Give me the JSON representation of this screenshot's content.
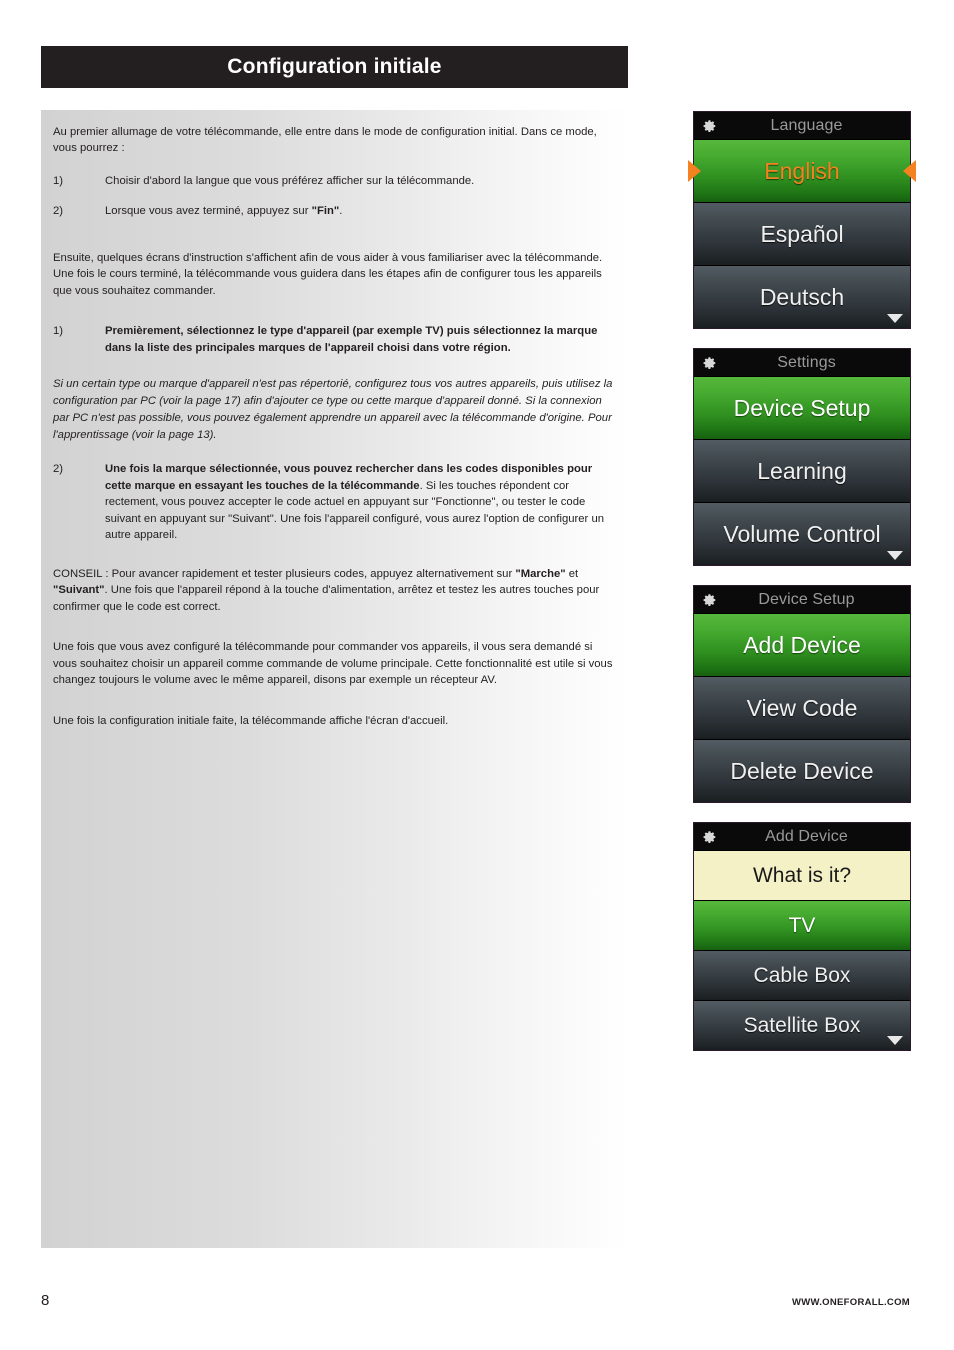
{
  "page": {
    "title": "Configuration initiale",
    "page_number": "8",
    "footer_url": "WWW.ONEFORALL.COM"
  },
  "content": {
    "intro": "Au premier allumage de votre télécommande, elle entre dans le mode de configuration initial. Dans ce mode, vous pourrez :",
    "list1": [
      {
        "num": "1)",
        "text": "Choisir d'abord la langue que vous préférez afficher sur la télécommande."
      },
      {
        "num": "2)",
        "text_before": "Lorsque vous avez terminé, appuyez sur ",
        "bold": "\"Fin\"",
        "text_after": "."
      }
    ],
    "para2": "Ensuite, quelques écrans d'instruction s'affichent afin de vous aider à vous familiariser avec la télécommande. Une fois le cours terminé, la télécommande vous guidera dans les étapes afin de configurer tous les appareils que vous souhaitez commander.",
    "item1_num": "1)",
    "item1_text": "Premièrement, sélectionnez le type d'appareil (par exemple TV) puis sélectionnez la marque dans la liste des principales marques de l'appareil choisi dans votre région.",
    "italic_note": "Si un certain type ou marque d'appareil n'est pas répertorié, configurez tous vos autres appareils, puis utilisez la configuration par PC (voir la page 17) afin d'ajouter ce type ou cette marque d'appareil donné. Si la connexion par PC n'est pas possible, vous pouvez également apprendre un appareil avec la télécommande d'origine. Pour l'apprentissage (voir la page 13).",
    "item2_num": "2)",
    "item2_bold": "Une fois la marque sélectionnée, vous pouvez rechercher dans les codes disponibles pour cette marque en essayant les touches de la télécommande",
    "item2_rest": ". Si les touches répondent cor rectement, vous pouvez accepter le code actuel en appuyant sur \"Fonctionne\", ou tester le code suivant en appuyant sur \"Suivant\". Une fois l'appareil configuré, vous aurez l'option de configurer un autre appareil.",
    "tip_before": "CONSEIL : Pour avancer rapidement et tester plusieurs codes, appuyez alternativement sur ",
    "tip_bold1": "\"Marche\"",
    "tip_mid": " et ",
    "tip_bold2": "\"Suivant\"",
    "tip_after": ". Une fois que l'appareil répond à la touche d'alimentation, arrêtez et testez les autres touches pour confirmer que le code est correct.",
    "para_volume": "Une fois que vous avez configuré la télécommande pour commander vos appareils, il vous sera demandé si vous souhaitez choisir un appareil comme commande de volume principale. Cette fonctionnalité est utile si vous changez toujours le volume avec le même appareil, disons par exemple un récepteur AV.",
    "para_final": "Une fois la configuration initiale faite, la télécommande affiche l'écran d'accueil."
  },
  "screens": [
    {
      "header": "Language",
      "icon": "gear-icon",
      "has_scroll_arrow": true,
      "rows": [
        {
          "label": "English",
          "style": "green",
          "selected": true,
          "arrows": true
        },
        {
          "label": "Español",
          "style": "dark"
        },
        {
          "label": "Deutsch",
          "style": "dark"
        }
      ]
    },
    {
      "header": "Settings",
      "icon": "gear-icon",
      "has_scroll_arrow": true,
      "rows": [
        {
          "label": "Device Setup",
          "style": "green"
        },
        {
          "label": "Learning",
          "style": "dark"
        },
        {
          "label": "Volume Control",
          "style": "dark"
        }
      ]
    },
    {
      "header": "Device Setup",
      "icon": "gear-icon",
      "has_scroll_arrow": false,
      "rows": [
        {
          "label": "Add Device",
          "style": "green"
        },
        {
          "label": "View Code",
          "style": "dark"
        },
        {
          "label": "Delete Device",
          "style": "dark"
        }
      ]
    },
    {
      "header": "Add Device",
      "icon": "gear-icon",
      "has_scroll_arrow": true,
      "rows": [
        {
          "label": "What is it?",
          "style": "cream"
        },
        {
          "label": "TV",
          "style": "green"
        },
        {
          "label": "Cable Box",
          "style": "dark"
        },
        {
          "label": "Satellite Box",
          "style": "dark"
        }
      ]
    }
  ],
  "colors": {
    "title_bar_bg": "#231f20",
    "green_accent": "#2f8f1f",
    "orange_accent": "#f58220",
    "cream": "#f4f1c6",
    "dark_row": "#343b40"
  }
}
